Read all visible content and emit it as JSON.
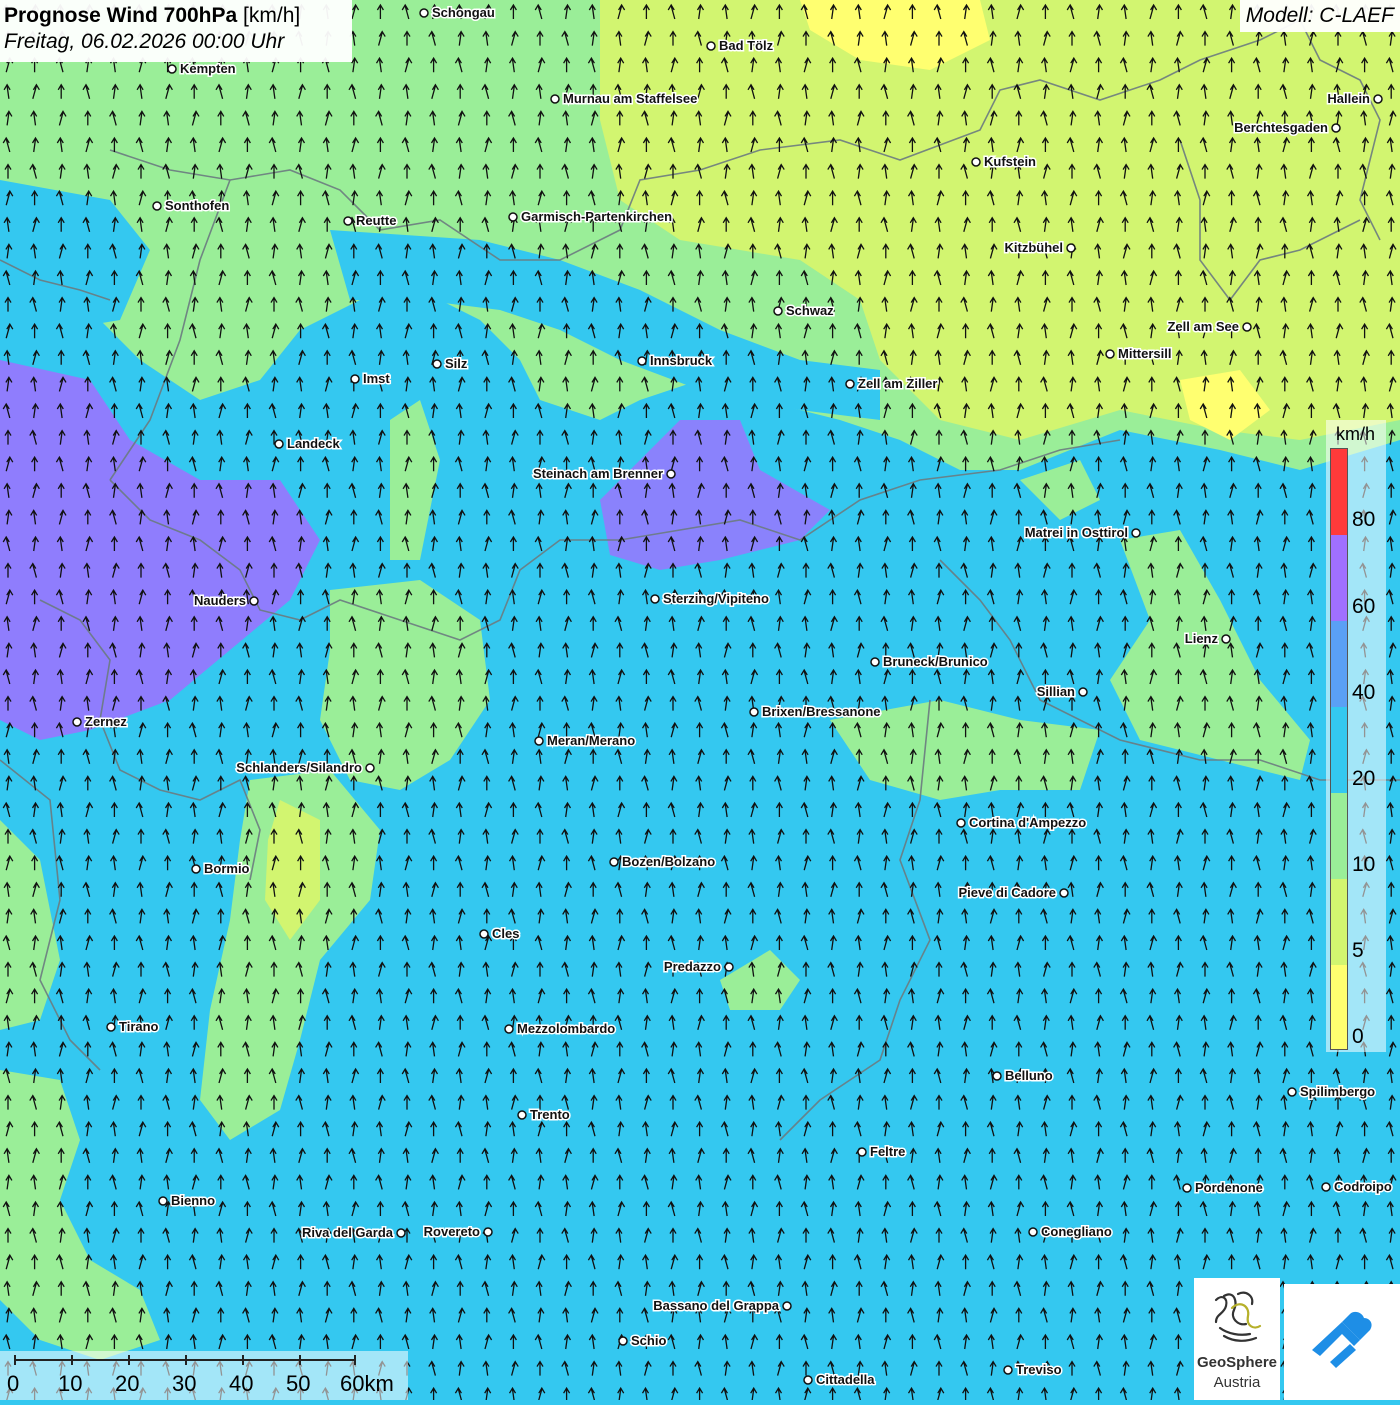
{
  "header": {
    "title_bold": "Prognose Wind 700hPa",
    "title_unit": "[km/h]",
    "subtitle": "Freitag, 06.02.2026 00:00 Uhr",
    "model": "Modell: C-LAEF"
  },
  "legend": {
    "unit": "km/h",
    "ticks": [
      "80",
      "60",
      "40",
      "20",
      "10",
      "5",
      "0"
    ],
    "colors": [
      "#ff3a3a",
      "#a070ff",
      "#5aa0f5",
      "#34c8f0",
      "#9aee98",
      "#d2f570",
      "#ffff70"
    ]
  },
  "scale_bar": {
    "labels": [
      "0",
      "10",
      "20",
      "30",
      "40",
      "50",
      "60km"
    ]
  },
  "branding": {
    "logo_name": "GeoSphere",
    "logo_sub": "Austria"
  },
  "map": {
    "wind_direction": "south-southwest to north",
    "colors": {
      "calm": "#ffff70",
      "light": "#d2f570",
      "moderate": "#9aee98",
      "fresh": "#34c8f0",
      "strong": "#5aa0f5",
      "very_strong": "#a070ff"
    },
    "cities": [
      {
        "name": "Schongau"
      },
      {
        "name": "Bad Tölz"
      },
      {
        "name": "Kempten"
      },
      {
        "name": "Murnau am Staffelsee"
      },
      {
        "name": "Hallein"
      },
      {
        "name": "Berchtesgaden"
      },
      {
        "name": "Kufstein"
      },
      {
        "name": "Sonthofen"
      },
      {
        "name": "Reutte"
      },
      {
        "name": "Garmisch-Partenkirchen"
      },
      {
        "name": "Kitzbühel"
      },
      {
        "name": "Schwaz"
      },
      {
        "name": "Zell am See"
      },
      {
        "name": "Mittersill"
      },
      {
        "name": "Innsbruck"
      },
      {
        "name": "Silz"
      },
      {
        "name": "Imst"
      },
      {
        "name": "Zell am Ziller"
      },
      {
        "name": "Landeck"
      },
      {
        "name": "Steinach am Brenner"
      },
      {
        "name": "Matrei in Osttirol"
      },
      {
        "name": "Nauders"
      },
      {
        "name": "Sterzing/Vipiteno"
      },
      {
        "name": "Lienz"
      },
      {
        "name": "Bruneck/Brunico"
      },
      {
        "name": "Sillian"
      },
      {
        "name": "Zernez"
      },
      {
        "name": "Brixen/Bressanone"
      },
      {
        "name": "Meran/Merano"
      },
      {
        "name": "Schlanders/Silandro"
      },
      {
        "name": "Cortina d'Ampezzo"
      },
      {
        "name": "Bozen/Bolzano"
      },
      {
        "name": "Bormio"
      },
      {
        "name": "Pieve di Cadore"
      },
      {
        "name": "Cles"
      },
      {
        "name": "Predazzo"
      },
      {
        "name": "Tirano"
      },
      {
        "name": "Mezzolombardo"
      },
      {
        "name": "Belluno"
      },
      {
        "name": "Spilimbergo"
      },
      {
        "name": "Trento"
      },
      {
        "name": "Feltre"
      },
      {
        "name": "Pordenone"
      },
      {
        "name": "Codroipo"
      },
      {
        "name": "Bienno"
      },
      {
        "name": "Riva del Garda"
      },
      {
        "name": "Rovereto"
      },
      {
        "name": "Conegliano"
      },
      {
        "name": "Bassano del Grappa"
      },
      {
        "name": "Schio"
      },
      {
        "name": "Treviso"
      },
      {
        "name": "Cittadella"
      }
    ]
  }
}
